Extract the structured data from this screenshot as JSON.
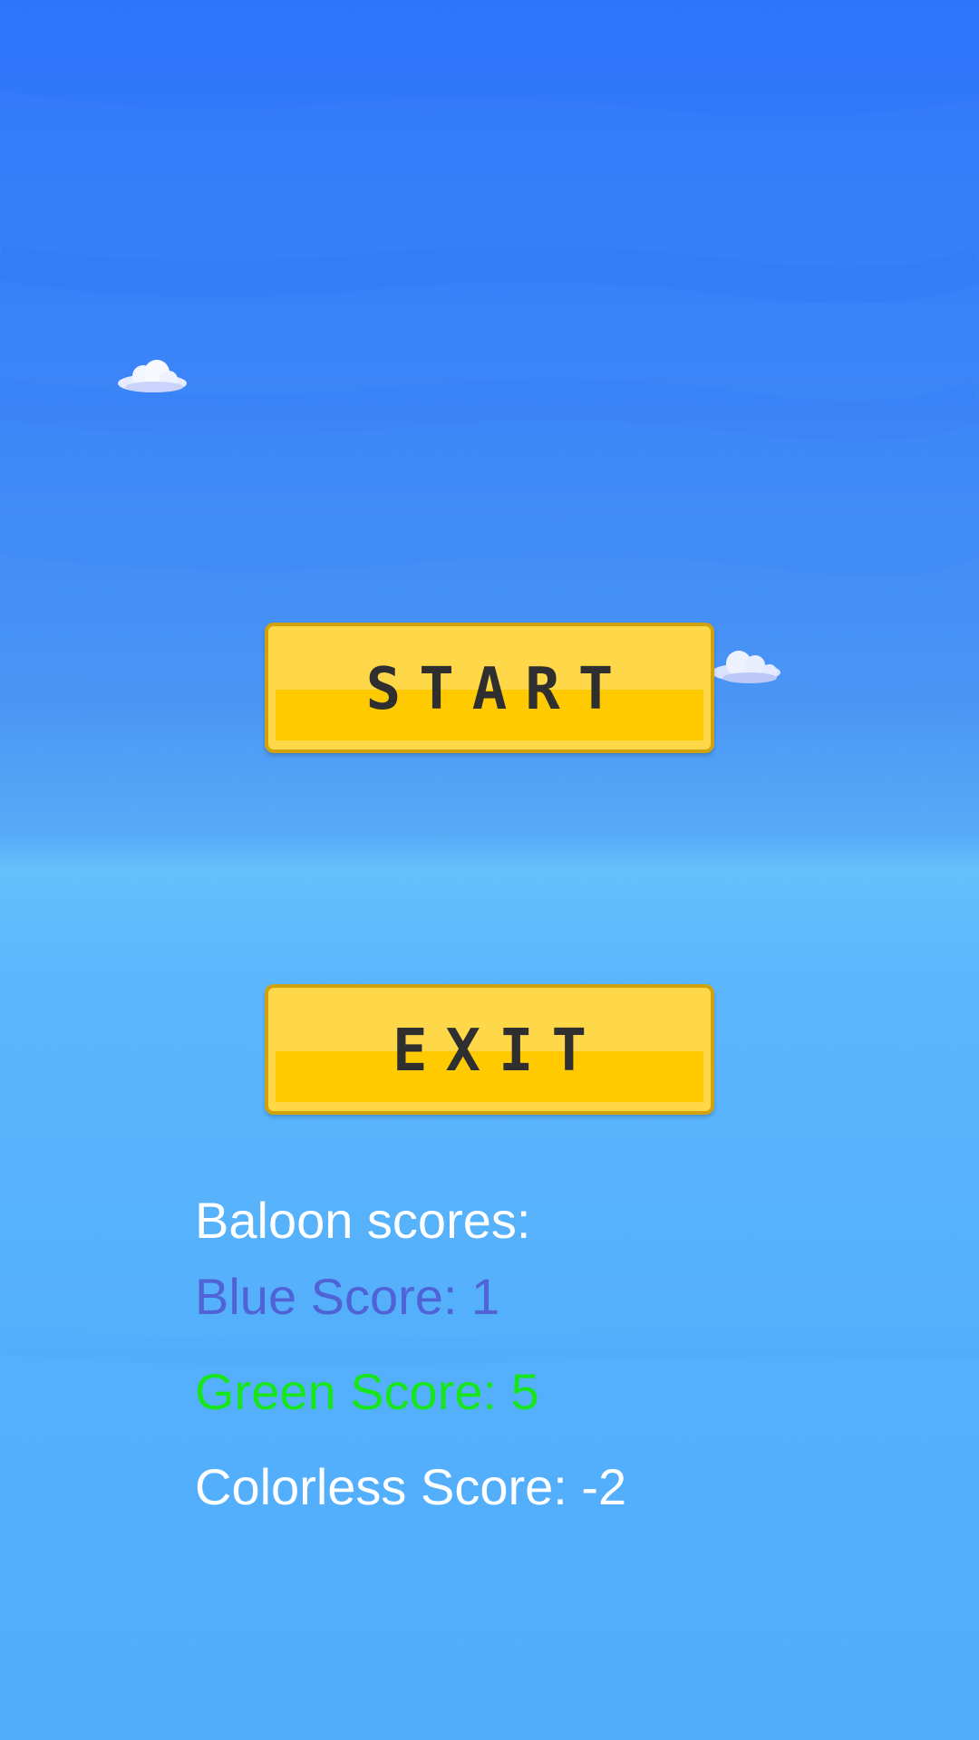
{
  "menu": {
    "start_label": "START",
    "exit_label": "EXIT"
  },
  "scores": {
    "heading": "Baloon scores:",
    "blue_label": "Blue Score: 1",
    "green_label": "Green Score: 5",
    "colorless_label": "Colorless Score: -2",
    "blue_value": 1,
    "green_value": 5,
    "colorless_value": -2
  },
  "colors": {
    "sky_top": "#3177fb",
    "sky_bottom": "#50aefd",
    "button_fill": "#ffcb00",
    "button_border": "#d2a20d",
    "button_text": "#2f2f2f",
    "blue_score": "#4f63d6",
    "green_score": "#18e61c",
    "white_text": "#ffffff"
  },
  "icons": {
    "cloud_left": "cloud-icon",
    "cloud_right": "cloud-icon"
  }
}
